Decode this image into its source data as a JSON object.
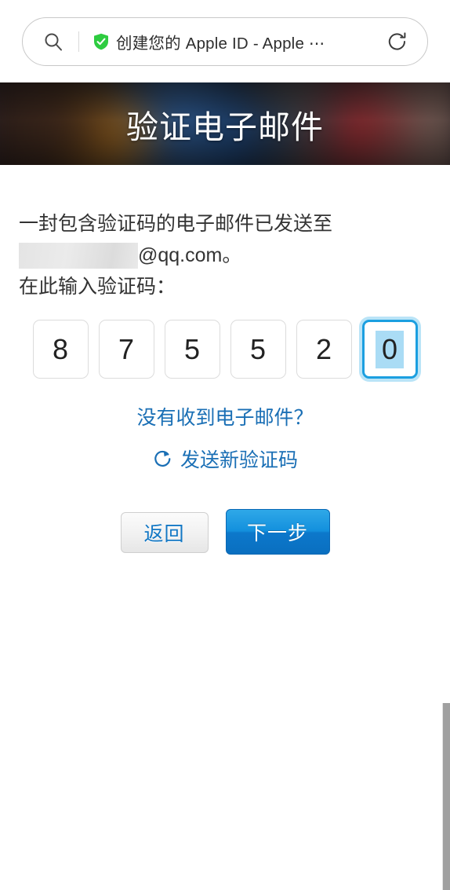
{
  "browser": {
    "search_icon": "search-icon",
    "shield_icon": "shield-check-icon",
    "tab_title": "创建您的 Apple ID - Apple ⋯",
    "reload_icon": "reload-icon"
  },
  "hero": {
    "title": "验证电子邮件"
  },
  "content": {
    "intro_line1": "一封包含验证码的电子邮件已发送至",
    "redacted_email_local": "",
    "email_domain": "@qq.com。",
    "intro_line3": "在此输入验证码：",
    "code_digits": [
      "8",
      "7",
      "5",
      "5",
      "2",
      "0"
    ],
    "focused_index": 5,
    "links": {
      "no_email": "没有收到电子邮件？",
      "resend": "发送新验证码",
      "resend_icon": "refresh-icon"
    },
    "buttons": {
      "back": "返回",
      "next": "下一步"
    }
  },
  "colors": {
    "link_blue": "#1a6fb5",
    "focus_blue": "#1b9fe0",
    "selection_blue": "#aadcf5",
    "primary_button_blue": "#1390dd",
    "shield_green": "#2ecc40"
  }
}
